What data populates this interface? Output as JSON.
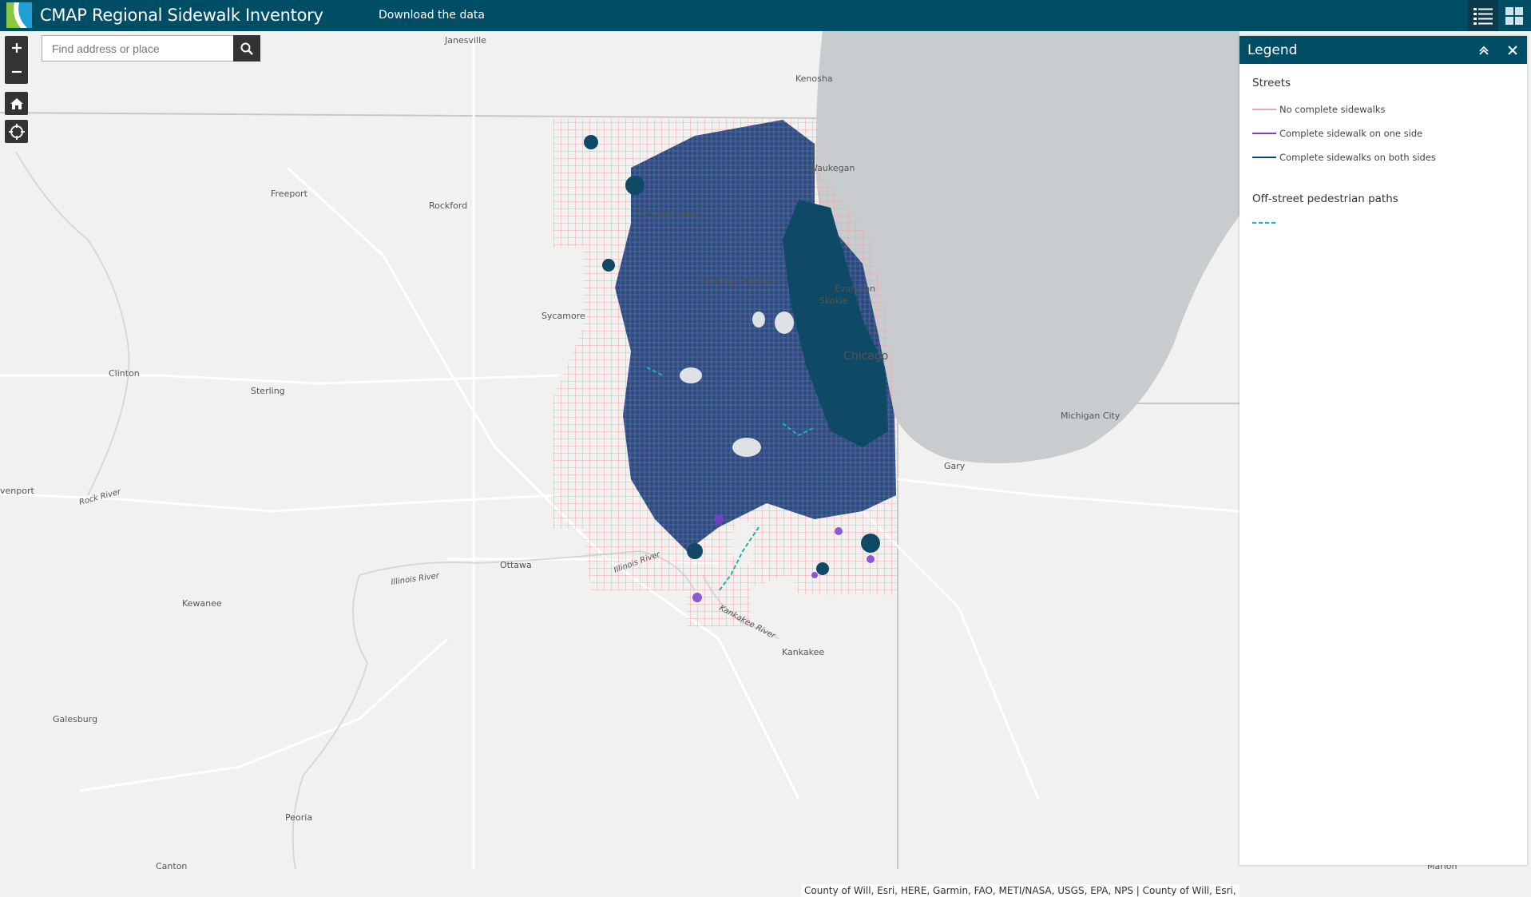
{
  "header": {
    "title": "CMAP Regional Sidewalk Inventory",
    "download_label": "Download the data"
  },
  "search": {
    "placeholder": "Find address or place"
  },
  "map": {
    "places": {
      "janesville": "Janesville",
      "kenosha": "Kenosha",
      "waukegan": "Waukegan",
      "freeport": "Freeport",
      "rockford": "Rockford",
      "crystal_lake": "Crystal Lake",
      "hoffman_estates": "Hoffman Estates",
      "evanston": "Evanston",
      "skokie": "Skokie",
      "sycamore": "Sycamore",
      "chicago": "Chicago",
      "clinton": "Clinton",
      "sterling": "Sterling",
      "michigan_city": "Michigan City",
      "davenport": "venport",
      "gary": "Gary",
      "ottawa": "Ottawa",
      "kewanee": "Kewanee",
      "kankakee": "Kankakee",
      "galesburg": "Galesburg",
      "peoria": "Peoria",
      "canton": "Canton",
      "marion": "Marion"
    },
    "rivers": {
      "rock": "Rock River",
      "illinois_left": "Illinois River",
      "illinois_right": "Illinois River",
      "kankakee": "Kankakee River"
    },
    "colors": {
      "lake": "#c9ccce",
      "land": "#f1f1f0",
      "no_sidewalk": "#f2a2a8",
      "one_side": "#7b3fd0",
      "both_sides": "#0e4a66",
      "paths": "#1fb0b0"
    }
  },
  "legend": {
    "title": "Legend",
    "streets_heading": "Streets",
    "items": [
      {
        "label": "No complete sidewalks",
        "color": "#f2a2a8"
      },
      {
        "label": "Complete sidewalk on one side",
        "color": "#7b3fd0"
      },
      {
        "label": "Complete sidewalks on both sides",
        "color": "#0e4a66"
      }
    ],
    "paths_heading": "Off-street pedestrian paths",
    "paths_color": "#1fb0b0"
  },
  "attribution": "County of Will, Esri, HERE, Garmin, FAO, METI/NASA, USGS, EPA, NPS | County of Will, Esri, H",
  "icons": [
    "plus-icon",
    "minus-icon",
    "home-icon",
    "locate-icon",
    "search-icon",
    "legend-list-icon",
    "layers-grid-icon",
    "collapse-icon",
    "close-icon"
  ]
}
